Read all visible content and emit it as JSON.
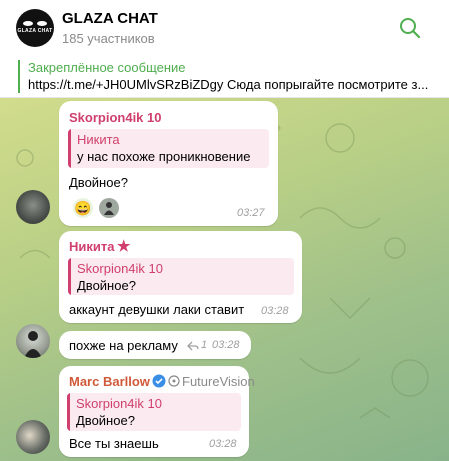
{
  "header": {
    "title": "GLAZA CHAT",
    "subtitle": "185 участников",
    "avatar_text": "GLAZA CHAT"
  },
  "pinned": {
    "title": "Закреплённое сообщение",
    "text": "https://t.me/+JH0UMlvSRzBiZDgy Сюда попрыгайте посмотрите з..."
  },
  "messages": [
    {
      "sender": "Skorpion4ik 10",
      "sender_color": "#d0406e",
      "quote_author": "Никита",
      "quote_text": "у нас похоже проникновение",
      "text": "Двойное?",
      "time": "03:27",
      "reactions": [
        "😄"
      ]
    },
    {
      "sender": "Никита",
      "sender_color": "#d0406e",
      "badge": "★",
      "quote_author": "Skorpion4ik 10",
      "quote_text": "Двойное?",
      "text": "аккаунт девушки лаки ставит",
      "time": "03:28"
    },
    {
      "text": "похже на рекламу",
      "reply_count": "1",
      "time": "03:28"
    },
    {
      "sender": "Marc Barllow",
      "sender_color": "#d05a3a",
      "verified_label": "FutureVision",
      "quote_author": "Skorpion4ik 10",
      "quote_text": "Двойное?",
      "text": "Все ты знаешь",
      "time": "03:28"
    }
  ],
  "colors": {
    "accent_green": "#4fae4e",
    "quote_pink": "#d0406e",
    "verified_blue": "#3a8ee6"
  }
}
